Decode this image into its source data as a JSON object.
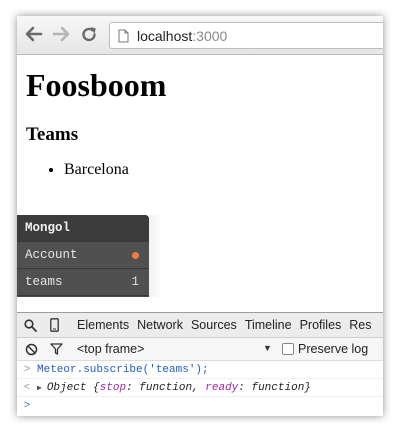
{
  "browser": {
    "url_host": "localhost",
    "url_port": ":3000",
    "back_icon": "back-arrow-icon",
    "forward_icon": "forward-arrow-icon",
    "reload_icon": "reload-icon",
    "page_icon": "document-icon"
  },
  "page": {
    "title": "Foosboom",
    "section_title": "Teams",
    "teams": [
      "Barcelona"
    ]
  },
  "mongol": {
    "header": "Mongol",
    "rows": [
      {
        "label": "Account",
        "indicator": "orange-dot",
        "indicator_color": "#f07d3a"
      },
      {
        "label": "teams",
        "count": "1"
      }
    ]
  },
  "devtools": {
    "tabs": [
      "Elements",
      "Network",
      "Sources",
      "Timeline",
      "Profiles",
      "Res"
    ],
    "frame_select": "<top frame>",
    "preserve_log_label": "Preserve log",
    "preserve_log_checked": false,
    "console": [
      {
        "type": "input",
        "prompt": ">",
        "text": "Meteor.subscribe('teams');"
      },
      {
        "type": "output",
        "prompt": "<",
        "prefix": "Object {",
        "key1": "stop",
        "val1": ": function, ",
        "key2": "ready",
        "val2": ": function}"
      },
      {
        "type": "prompt",
        "prompt": ">"
      }
    ]
  }
}
